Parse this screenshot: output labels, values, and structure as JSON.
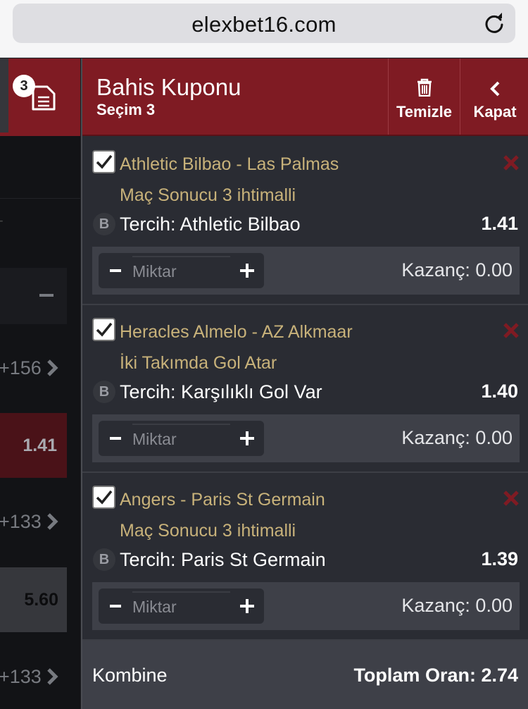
{
  "browser": {
    "url": "elexbet16.com"
  },
  "sidebar": {
    "coupon_count": "3",
    "rows": [
      {
        "text": "-",
        "odd": "",
        "kind": "dash"
      },
      {
        "text": "+156",
        "odd": "",
        "kind": "more"
      },
      {
        "text": "",
        "odd": "1.41",
        "kind": "odd-selected"
      },
      {
        "text": "+133",
        "odd": "",
        "kind": "more"
      },
      {
        "text": "",
        "odd": "5.60",
        "kind": "odd"
      },
      {
        "text": "+133",
        "odd": "",
        "kind": "more"
      }
    ]
  },
  "panel": {
    "title": "Bahis Kuponu",
    "subtitle": "Seçim 3",
    "clear_label": "Temizle",
    "close_label": "Kapat"
  },
  "selections": [
    {
      "match": "Athletic Bilbao - Las Palmas",
      "market": "Maç Sonucu 3 ihtimalli",
      "badge": "B",
      "pick": "Tercih: Athletic Bilbao",
      "odd": "1.41",
      "stake_placeholder": "Miktar",
      "winnings": "Kazanç: 0.00"
    },
    {
      "match": "Heracles Almelo - AZ Alkmaar",
      "market": "İki Takımda Gol Atar",
      "badge": "B",
      "pick": "Tercih: Karşılıklı Gol Var",
      "odd": "1.40",
      "stake_placeholder": "Miktar",
      "winnings": "Kazanç: 0.00"
    },
    {
      "match": "Angers - Paris St Germain",
      "market": "Maç Sonucu 3 ihtimalli",
      "badge": "B",
      "pick": "Tercih: Paris St Germain",
      "odd": "1.39",
      "stake_placeholder": "Miktar",
      "winnings": "Kazanç: 0.00"
    }
  ],
  "footer": {
    "label": "Kombine",
    "total": "Toplam Oran: 2.74"
  },
  "colors": {
    "header_red": "#7f1b23",
    "panel_bg": "#2a2c33",
    "stake_row_bg": "#3e4048",
    "match_text": "#c8b27a",
    "remove_icon": "#7f1b23"
  }
}
